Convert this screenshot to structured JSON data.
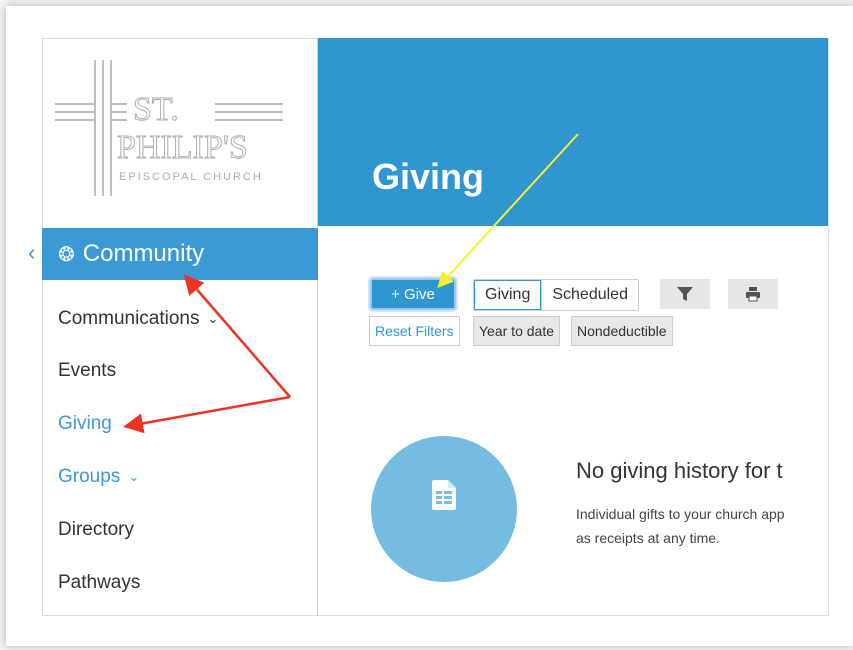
{
  "logo": {
    "line1": "ST.",
    "line2": "PHILIP'S",
    "line3": "EPISCOPAL CHURCH"
  },
  "sidebar": {
    "section_label": "Community",
    "items": [
      {
        "label": "Communications",
        "has_chevron": true,
        "active": false
      },
      {
        "label": "Events",
        "has_chevron": false,
        "active": false
      },
      {
        "label": "Giving",
        "has_chevron": false,
        "active": true
      },
      {
        "label": "Groups",
        "has_chevron": true,
        "active": true
      },
      {
        "label": "Directory",
        "has_chevron": false,
        "active": false
      },
      {
        "label": "Pathways",
        "has_chevron": false,
        "active": false
      }
    ]
  },
  "header": {
    "title": "Giving"
  },
  "toolbar": {
    "give_label": "+ Give",
    "tabs": [
      "Giving",
      "Scheduled"
    ],
    "filters": [
      "Reset Filters",
      "Year to date",
      "Nondeductible"
    ]
  },
  "empty_state": {
    "title": "No giving history for t",
    "desc_line1": "Individual gifts to your church app",
    "desc_line2": "as receipts at any time."
  },
  "colors": {
    "accent": "#2f96d0",
    "annotation_red": "#ee3322",
    "annotation_yellow": "#f5f030"
  },
  "icons": {
    "community": "community-icon",
    "filter": "filter-icon",
    "print": "print-icon",
    "document": "document-icon"
  }
}
